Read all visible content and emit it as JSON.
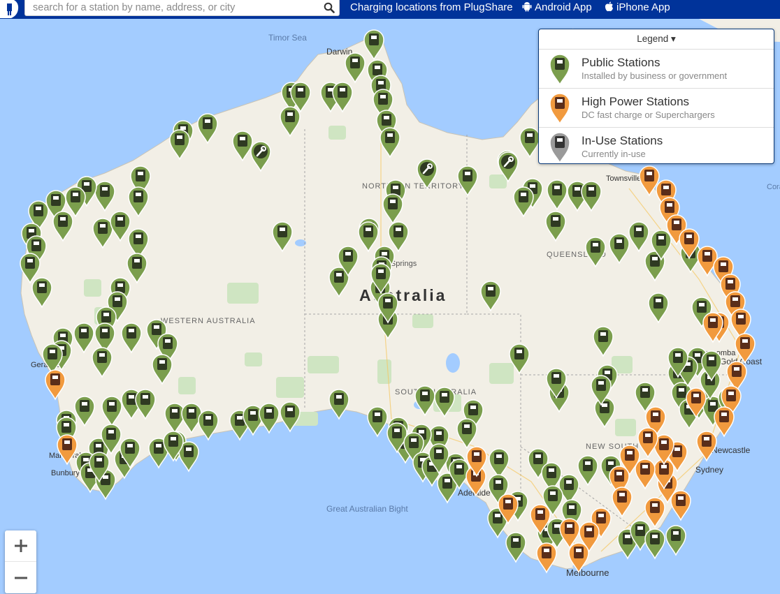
{
  "search": {
    "placeholder": "search for a station by name, address, or city"
  },
  "header": {
    "title": "Charging locations from PlugShare",
    "android_label": "Android App",
    "iphone_label": "iPhone App"
  },
  "legend": {
    "title": "Legend ▾",
    "items": [
      {
        "name": "Public Stations",
        "description": "Installed by business or government",
        "color": "#7b9e4d"
      },
      {
        "name": "High Power Stations",
        "description": "DC fast charge or Superchargers",
        "color": "#f19a3e"
      },
      {
        "name": "In-Use Stations",
        "description": "Currently in-use",
        "color": "#9a9a9a"
      }
    ]
  },
  "map": {
    "labels": {
      "timor_sea": "Timor Sea",
      "darwin": "Darwin",
      "northern_territory": "NORTHERN TERRITORY",
      "queensland": "QUEENSLAND",
      "western_australia": "WESTERN AUSTRALIA",
      "australia": "Australia",
      "alice_springs": "Alice Springs",
      "south_australia": "SOUTH AUSTRALIA",
      "new_south_wales": "NEW SOUTH WALES",
      "great_australian_bight": "Great Australian Bight",
      "townsville": "Townsville",
      "toowoomba": "Toowoomba",
      "gold_coast": "Gold Coast",
      "newcastle": "Newcastle",
      "sydney": "Sydney",
      "adelaide": "Adelaide",
      "melbourne": "Melbourne",
      "geraldton": "Geraldton",
      "mandurah": "Mandurah",
      "bunbury": "Bunbury",
      "coral_sea": "Coral Sea"
    }
  },
  "zoom": {
    "in": "+",
    "out": "−"
  }
}
